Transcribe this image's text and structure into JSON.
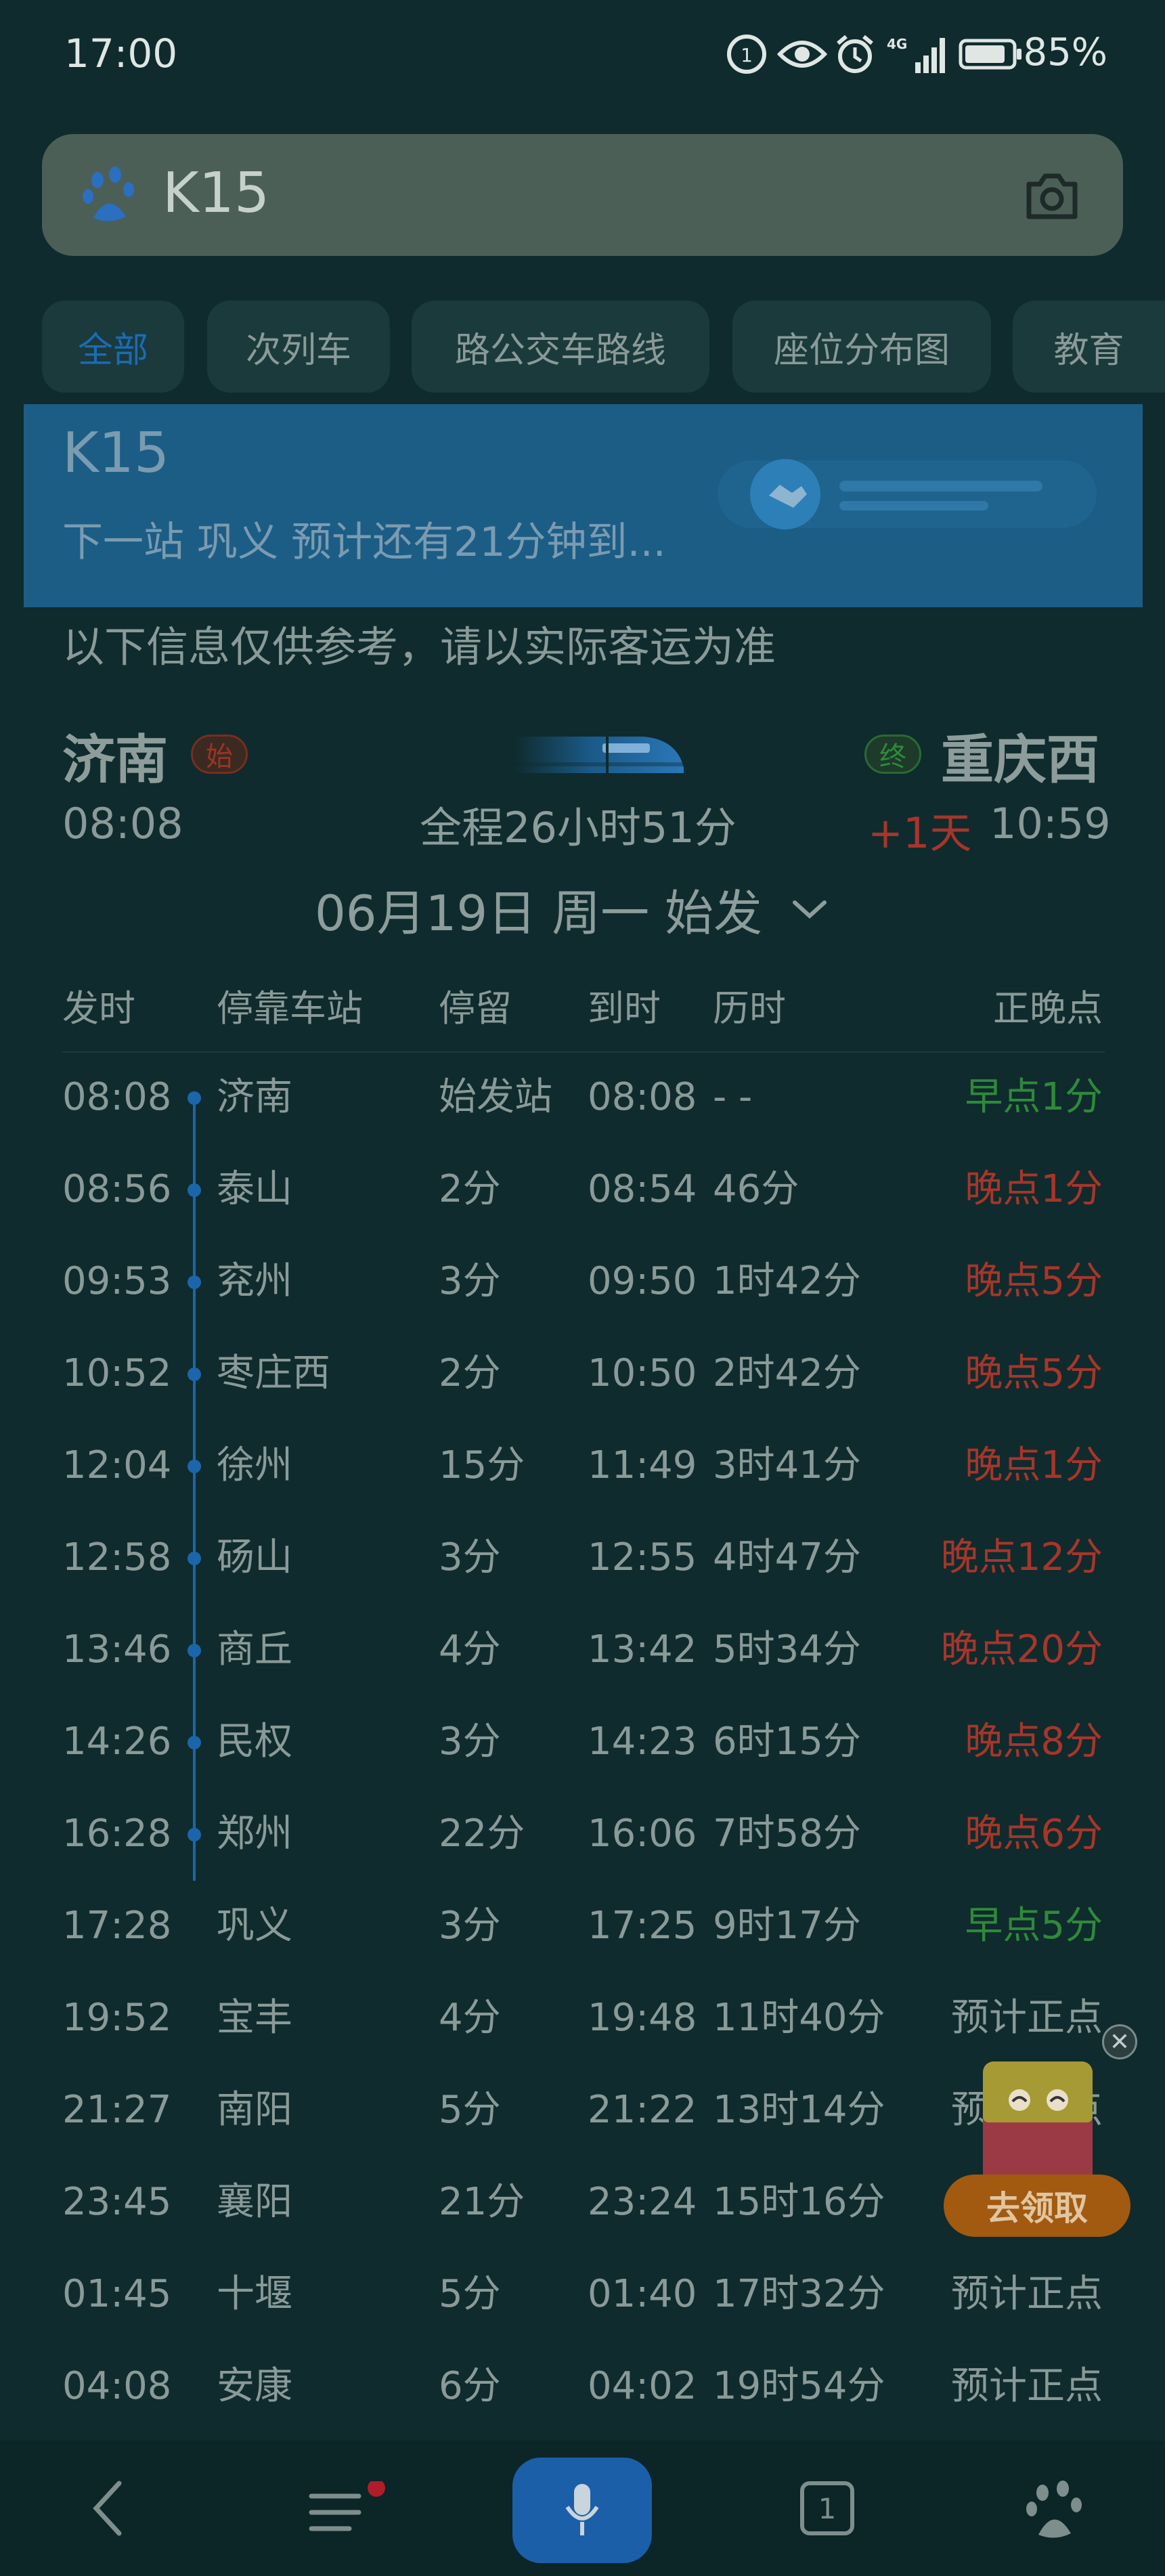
{
  "status_bar": {
    "time": "17:00",
    "battery": "85%",
    "icons": [
      "hd-icon",
      "eye-icon",
      "alarm-icon",
      "signal-4g-icon",
      "battery-icon"
    ]
  },
  "search": {
    "query": "K15",
    "logo": "baidu-paw-icon",
    "camera": "camera-icon"
  },
  "tabs": [
    {
      "label": "全部",
      "active": true
    },
    {
      "label": "次列车",
      "active": false
    },
    {
      "label": "路公交车路线",
      "active": false
    },
    {
      "label": "座位分布图",
      "active": false
    },
    {
      "label": "教育",
      "active": false
    }
  ],
  "banner": {
    "title": "K15",
    "subtitle": "下一站 巩义 预计还有21分钟到..."
  },
  "disclaimer": "以下信息仅供参考，请以实际客运为准",
  "route": {
    "from": "济南",
    "from_badge": "始",
    "to": "重庆西",
    "to_badge": "终",
    "depart": "08:08",
    "duration": "全程26小时51分",
    "day_offset": "+1天",
    "arrive": "10:59",
    "date": "06月19日 周一 始发"
  },
  "table": {
    "headers": [
      "发时",
      "停靠车站",
      "停留",
      "到时",
      "历时",
      "正晚点"
    ],
    "rows": [
      {
        "dep": "08:08",
        "station": "济南",
        "stop": "始发站",
        "arr": "08:08",
        "elapsed": "- -",
        "status": "早点1分",
        "status_type": "early",
        "passed": true
      },
      {
        "dep": "08:56",
        "station": "泰山",
        "stop": "2分",
        "arr": "08:54",
        "elapsed": "46分",
        "status": "晚点1分",
        "status_type": "late",
        "passed": true
      },
      {
        "dep": "09:53",
        "station": "兖州",
        "stop": "3分",
        "arr": "09:50",
        "elapsed": "1时42分",
        "status": "晚点5分",
        "status_type": "late",
        "passed": true
      },
      {
        "dep": "10:52",
        "station": "枣庄西",
        "stop": "2分",
        "arr": "10:50",
        "elapsed": "2时42分",
        "status": "晚点5分",
        "status_type": "late",
        "passed": true
      },
      {
        "dep": "12:04",
        "station": "徐州",
        "stop": "15分",
        "arr": "11:49",
        "elapsed": "3时41分",
        "status": "晚点1分",
        "status_type": "late",
        "passed": true
      },
      {
        "dep": "12:58",
        "station": "砀山",
        "stop": "3分",
        "arr": "12:55",
        "elapsed": "4时47分",
        "status": "晚点12分",
        "status_type": "late",
        "passed": true
      },
      {
        "dep": "13:46",
        "station": "商丘",
        "stop": "4分",
        "arr": "13:42",
        "elapsed": "5时34分",
        "status": "晚点20分",
        "status_type": "late",
        "passed": true
      },
      {
        "dep": "14:26",
        "station": "民权",
        "stop": "3分",
        "arr": "14:23",
        "elapsed": "6时15分",
        "status": "晚点8分",
        "status_type": "late",
        "passed": true
      },
      {
        "dep": "16:28",
        "station": "郑州",
        "stop": "22分",
        "arr": "16:06",
        "elapsed": "7时58分",
        "status": "晚点6分",
        "status_type": "late",
        "passed": true
      },
      {
        "dep": "17:28",
        "station": "巩义",
        "stop": "3分",
        "arr": "17:25",
        "elapsed": "9时17分",
        "status": "早点5分",
        "status_type": "early",
        "passed": false
      },
      {
        "dep": "19:52",
        "station": "宝丰",
        "stop": "4分",
        "arr": "19:48",
        "elapsed": "11时40分",
        "status": "预计正点",
        "status_type": "normal",
        "passed": false
      },
      {
        "dep": "21:27",
        "station": "南阳",
        "stop": "5分",
        "arr": "21:22",
        "elapsed": "13时14分",
        "status": "预计正点",
        "status_type": "normal",
        "passed": false
      },
      {
        "dep": "23:45",
        "station": "襄阳",
        "stop": "21分",
        "arr": "23:24",
        "elapsed": "15时16分",
        "status": "",
        "status_type": "normal",
        "passed": false
      },
      {
        "dep": "01:45",
        "station": "十堰",
        "stop": "5分",
        "arr": "01:40",
        "elapsed": "17时32分",
        "status": "预计正点",
        "status_type": "normal",
        "passed": false
      },
      {
        "dep": "04:08",
        "station": "安康",
        "stop": "6分",
        "arr": "04:02",
        "elapsed": "19时54分",
        "status": "预计正点",
        "status_type": "normal",
        "passed": false
      }
    ]
  },
  "promo": {
    "button": "去领取",
    "close": "✕"
  },
  "bottom_nav": {
    "tab_count": "1"
  },
  "colors": {
    "early": "#2e8a3a",
    "late": "#a8352a",
    "normal": "#8a9a98",
    "accent": "#1b66aa"
  }
}
